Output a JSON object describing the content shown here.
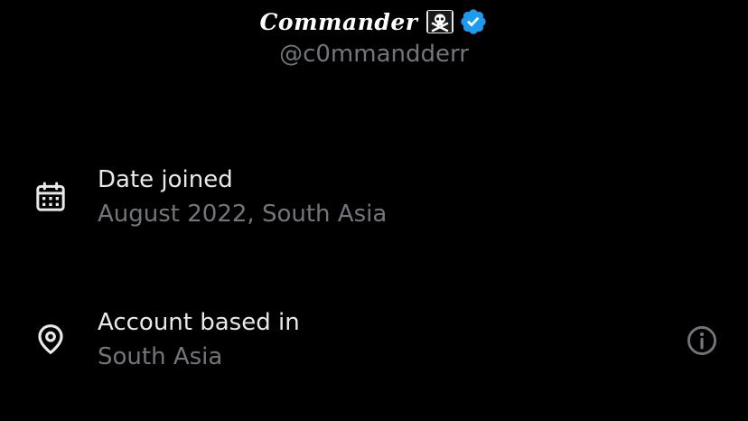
{
  "profile": {
    "display_name": "Commander",
    "handle": "@c0mmandderr",
    "name_emoji": "skull-crossbones-icon",
    "verified": "verified-badge-icon"
  },
  "details": {
    "date_joined": {
      "label": "Date joined",
      "value": "August 2022, South Asia",
      "icon": "calendar-icon"
    },
    "account_based": {
      "label": "Account based in",
      "value": "South Asia",
      "icon": "location-pin-icon",
      "action_icon": "info-icon"
    }
  },
  "colors": {
    "background": "#000000",
    "primary_text": "#e7e9ea",
    "secondary_text": "#71767b",
    "verified_blue": "#1d9bf0"
  }
}
